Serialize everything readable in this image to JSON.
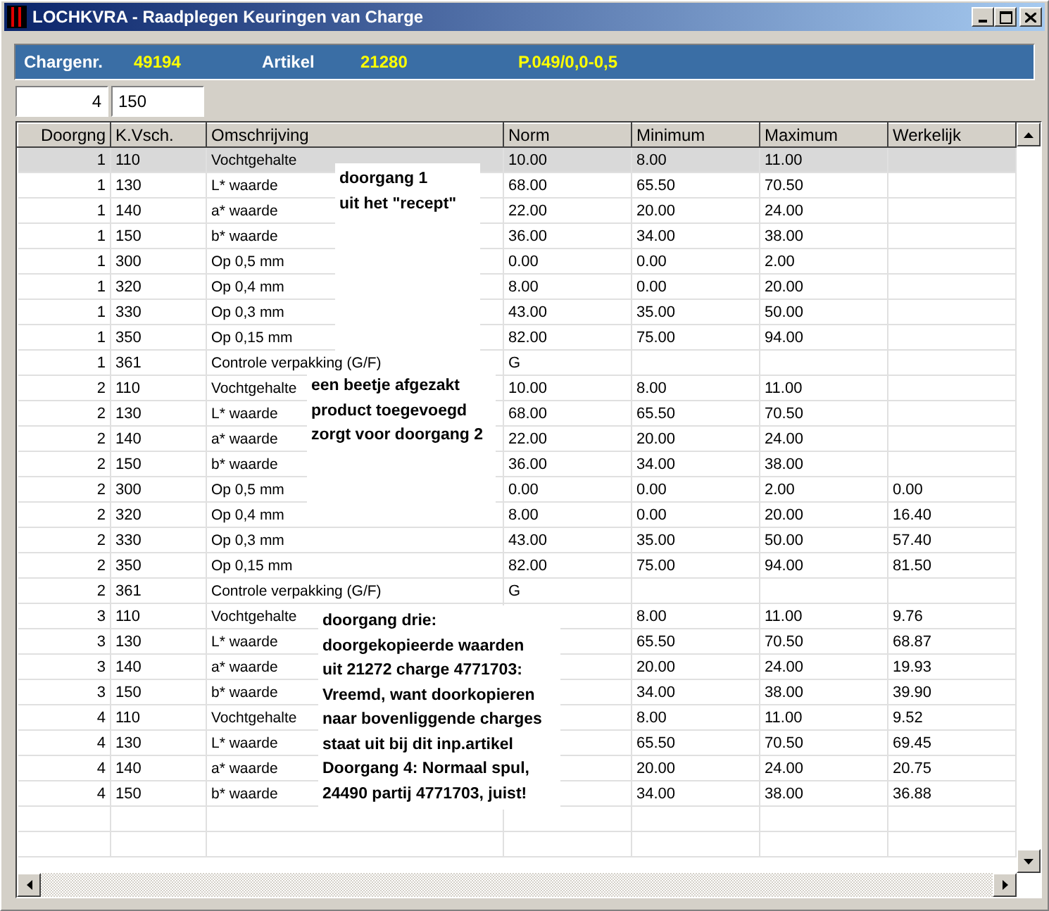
{
  "window": {
    "title": "LOCHKVRA - Raadplegen Keuringen van Charge"
  },
  "header": {
    "charge_label": "Chargenr.",
    "charge_value": "49194",
    "article_label": "Artikel",
    "article_value": "21280",
    "article_description": "P.049/0,0-0,5"
  },
  "filters": [
    {
      "value": "4"
    },
    {
      "value": "150"
    }
  ],
  "table": {
    "columns": [
      "Doorgng",
      "K.Vsch.",
      "Omschrijving",
      "Norm",
      "Minimum",
      "Maximum",
      "Werkelijk"
    ],
    "rows": [
      {
        "doorgang": "1",
        "code": "110",
        "omschrijving": "Vochtgehalte",
        "norm": "10.00",
        "minimum": "8.00",
        "maximum": "11.00",
        "selected": true
      },
      {
        "doorgang": "1",
        "code": "130",
        "omschrijving": "L* waarde",
        "norm": "68.00",
        "minimum": "65.50",
        "maximum": "70.50",
        "selected": false
      },
      {
        "doorgang": "1",
        "code": "140",
        "omschrijving": "a* waarde",
        "norm": "22.00",
        "minimum": "20.00",
        "maximum": "24.00",
        "selected": false
      },
      {
        "doorgang": "1",
        "code": "150",
        "omschrijving": "b* waarde",
        "norm": "36.00",
        "minimum": "34.00",
        "maximum": "38.00",
        "selected": false
      },
      {
        "doorgang": "1",
        "code": "300",
        "omschrijving": "Op 0,5 mm",
        "norm": "0.00",
        "minimum": "0.00",
        "maximum": "2.00",
        "selected": false
      },
      {
        "doorgang": "1",
        "code": "320",
        "omschrijving": "Op 0,4 mm",
        "norm": "8.00",
        "minimum": "0.00",
        "maximum": "20.00",
        "selected": false
      },
      {
        "doorgang": "1",
        "code": "330",
        "omschrijving": "Op 0,3 mm",
        "norm": "43.00",
        "minimum": "35.00",
        "maximum": "50.00",
        "selected": false
      },
      {
        "doorgang": "1",
        "code": "350",
        "omschrijving": "Op 0,15 mm",
        "norm": "82.00",
        "minimum": "75.00",
        "maximum": "94.00",
        "selected": false
      },
      {
        "doorgang": "1",
        "code": "361",
        "omschrijving": "Controle verpakking (G/F)",
        "norm": "G",
        "selected": false
      },
      {
        "doorgang": "2",
        "code": "110",
        "omschrijving": "Vochtgehalte",
        "norm": "10.00",
        "minimum": "8.00",
        "maximum": "11.00",
        "selected": false
      },
      {
        "doorgang": "2",
        "code": "130",
        "omschrijving": "L* waarde",
        "norm": "68.00",
        "minimum": "65.50",
        "maximum": "70.50",
        "selected": false
      },
      {
        "doorgang": "2",
        "code": "140",
        "omschrijving": "a* waarde",
        "norm": "22.00",
        "minimum": "20.00",
        "maximum": "24.00",
        "selected": false
      },
      {
        "doorgang": "2",
        "code": "150",
        "omschrijving": "b* waarde",
        "norm": "36.00",
        "minimum": "34.00",
        "maximum": "38.00",
        "selected": false
      },
      {
        "doorgang": "2",
        "code": "300",
        "omschrijving": "Op 0,5 mm",
        "norm": "0.00",
        "minimum": "0.00",
        "maximum": "2.00",
        "werkelijk": "0.00",
        "selected": false
      },
      {
        "doorgang": "2",
        "code": "320",
        "omschrijving": "Op 0,4 mm",
        "norm": "8.00",
        "minimum": "0.00",
        "maximum": "20.00",
        "werkelijk": "16.40",
        "selected": false
      },
      {
        "doorgang": "2",
        "code": "330",
        "omschrijving": "Op 0,3 mm",
        "norm": "43.00",
        "minimum": "35.00",
        "maximum": "50.00",
        "werkelijk": "57.40",
        "selected": false
      },
      {
        "doorgang": "2",
        "code": "350",
        "omschrijving": "Op 0,15 mm",
        "norm": "82.00",
        "minimum": "75.00",
        "maximum": "94.00",
        "werkelijk": "81.50",
        "selected": false
      },
      {
        "doorgang": "2",
        "code": "361",
        "omschrijving": "Controle verpakking (G/F)",
        "norm": "G",
        "selected": false
      },
      {
        "doorgang": "3",
        "code": "110",
        "omschrijving": "Vochtgehalte",
        "minimum": "8.00",
        "maximum": "11.00",
        "werkelijk": "9.76",
        "selected": false
      },
      {
        "doorgang": "3",
        "code": "130",
        "omschrijving": "L* waarde",
        "minimum": "65.50",
        "maximum": "70.50",
        "werkelijk": "68.87",
        "selected": false
      },
      {
        "doorgang": "3",
        "code": "140",
        "omschrijving": "a* waarde",
        "minimum": "20.00",
        "maximum": "24.00",
        "werkelijk": "19.93",
        "selected": false
      },
      {
        "doorgang": "3",
        "code": "150",
        "omschrijving": "b* waarde",
        "minimum": "34.00",
        "maximum": "38.00",
        "werkelijk": "39.90",
        "selected": false
      },
      {
        "doorgang": "4",
        "code": "110",
        "omschrijving": "Vochtgehalte",
        "minimum": "8.00",
        "maximum": "11.00",
        "werkelijk": "9.52",
        "selected": false
      },
      {
        "doorgang": "4",
        "code": "130",
        "omschrijving": "L* waarde",
        "minimum": "65.50",
        "maximum": "70.50",
        "werkelijk": "69.45",
        "selected": false
      },
      {
        "doorgang": "4",
        "code": "140",
        "omschrijving": "a* waarde",
        "minimum": "20.00",
        "maximum": "24.00",
        "werkelijk": "20.75",
        "selected": false
      },
      {
        "doorgang": "4",
        "code": "150",
        "omschrijving": "b* waarde",
        "minimum": "34.00",
        "maximum": "38.00",
        "werkelijk": "36.88",
        "selected": false
      }
    ]
  },
  "annotations": [
    {
      "text": "doorgang 1\nuit het \"recept\""
    },
    {
      "text": "een beetje afgezakt\nproduct toegevoegd\nzorgt voor doorgang 2"
    },
    {
      "text": "doorgang drie:\ndoorgekopieerde waarden\nuit 21272 charge 4771703:\nVreemd, want doorkopieren\nnaar bovenliggende charges\nstaat uit bij dit inp.artikel\nDoorgang 4: Normaal spul,\n24490 partij 4771703, juist!"
    }
  ]
}
